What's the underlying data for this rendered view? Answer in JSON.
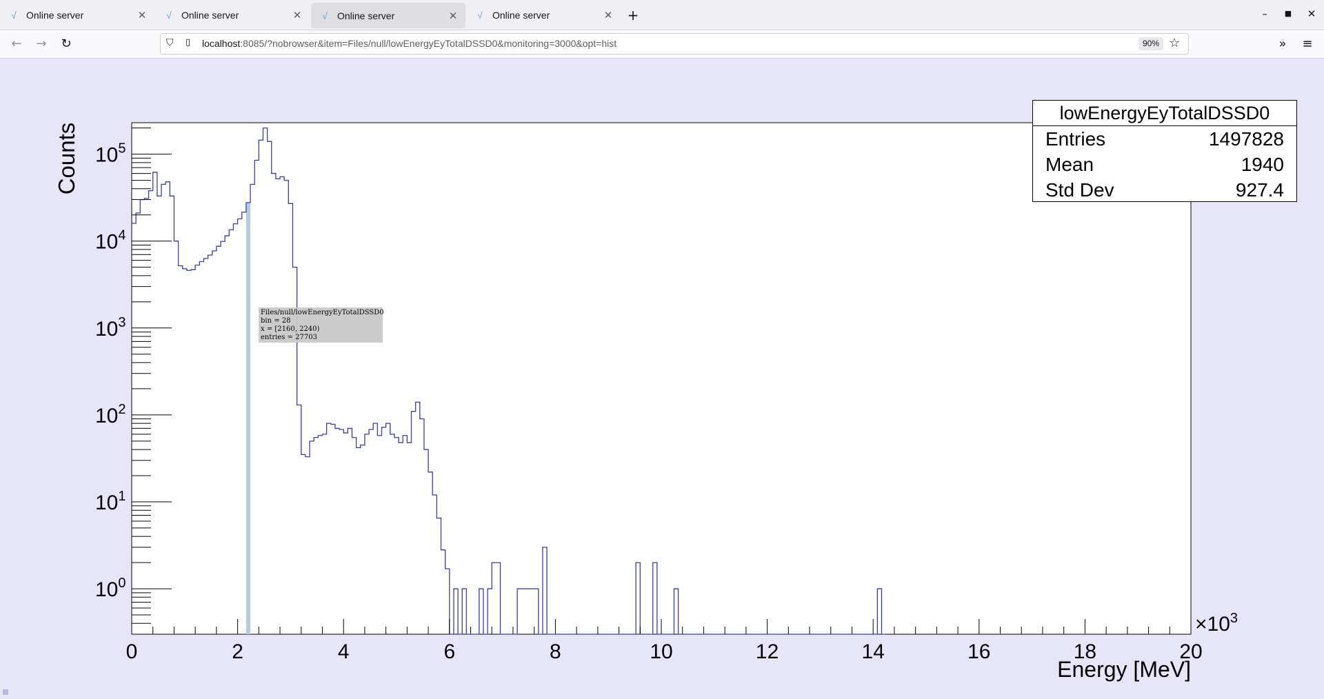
{
  "browser": {
    "tabs": [
      {
        "label": "Online server",
        "active": false
      },
      {
        "label": "Online server",
        "active": false
      },
      {
        "label": "Online server",
        "active": true
      },
      {
        "label": "Online server",
        "active": false
      }
    ],
    "url_host": "localhost",
    "url_rest": ":8085/?nobrowser&item=Files/null/lowEnergyEyTotalDSSD0&monitoring=3000&opt=hist",
    "zoom": "90%"
  },
  "tooltip": {
    "line1": "Files/null/lowEnergyEyTotalDSSD0",
    "line2": "bin = 28",
    "line3": "x = [2160, 2240)",
    "line4": "entries = 27703"
  },
  "stats": {
    "title": "lowEnergyEyTotalDSSD0",
    "rows": [
      {
        "label": "Entries",
        "value": "1497828"
      },
      {
        "label": "Mean",
        "value": "1940"
      },
      {
        "label": "Std Dev",
        "value": "927.4"
      }
    ]
  },
  "chart_data": {
    "type": "histogram",
    "xlabel": "Energy [MeV]",
    "ylabel": "Counts",
    "x_multiplier": "×10",
    "x_multiplier_exp": "3",
    "xlim": [
      0,
      20000
    ],
    "ylim": [
      0.3,
      230000
    ],
    "log_y": true,
    "x_ticks": [
      0,
      2,
      4,
      6,
      8,
      10,
      12,
      14,
      16,
      18,
      20
    ],
    "y_ticks": [
      {
        "base": "10",
        "exp": "0",
        "value": 1
      },
      {
        "base": "10",
        "exp": "1",
        "value": 10
      },
      {
        "base": "10",
        "exp": "2",
        "value": 100
      },
      {
        "base": "10",
        "exp": "3",
        "value": 1000
      },
      {
        "base": "10",
        "exp": "4",
        "value": 10000
      },
      {
        "base": "10",
        "exp": "5",
        "value": 100000
      }
    ],
    "bin_width": 80,
    "highlight_bin": {
      "x0": 2160,
      "x1": 2240
    },
    "line_color": "#3a3aa8",
    "highlight_color": "#b7c9e0",
    "bins": [
      [
        0,
        16000
      ],
      [
        80,
        21000
      ],
      [
        160,
        30000
      ],
      [
        240,
        31000
      ],
      [
        320,
        38000
      ],
      [
        400,
        62000
      ],
      [
        480,
        33000
      ],
      [
        560,
        45000
      ],
      [
        640,
        48000
      ],
      [
        720,
        33000
      ],
      [
        800,
        10000
      ],
      [
        880,
        5200
      ],
      [
        960,
        4800
      ],
      [
        1040,
        4600
      ],
      [
        1120,
        4700
      ],
      [
        1200,
        5300
      ],
      [
        1280,
        5800
      ],
      [
        1360,
        6300
      ],
      [
        1440,
        6900
      ],
      [
        1520,
        7700
      ],
      [
        1600,
        8700
      ],
      [
        1680,
        9900
      ],
      [
        1760,
        11500
      ],
      [
        1840,
        13500
      ],
      [
        1920,
        15800
      ],
      [
        2000,
        18000
      ],
      [
        2080,
        21500
      ],
      [
        2160,
        27703
      ],
      [
        2240,
        45000
      ],
      [
        2320,
        85000
      ],
      [
        2400,
        145000
      ],
      [
        2480,
        200000
      ],
      [
        2560,
        140000
      ],
      [
        2640,
        60000
      ],
      [
        2720,
        52000
      ],
      [
        2800,
        55000
      ],
      [
        2880,
        50000
      ],
      [
        2960,
        27000
      ],
      [
        3040,
        5000
      ],
      [
        3120,
        130
      ],
      [
        3200,
        35
      ],
      [
        3280,
        33
      ],
      [
        3360,
        50
      ],
      [
        3440,
        55
      ],
      [
        3520,
        58
      ],
      [
        3600,
        60
      ],
      [
        3680,
        80
      ],
      [
        3760,
        78
      ],
      [
        3840,
        70
      ],
      [
        3920,
        68
      ],
      [
        4000,
        62
      ],
      [
        4080,
        70
      ],
      [
        4160,
        55
      ],
      [
        4240,
        42
      ],
      [
        4320,
        45
      ],
      [
        4400,
        60
      ],
      [
        4480,
        68
      ],
      [
        4560,
        80
      ],
      [
        4640,
        58
      ],
      [
        4720,
        72
      ],
      [
        4800,
        80
      ],
      [
        4880,
        60
      ],
      [
        4960,
        55
      ],
      [
        5040,
        48
      ],
      [
        5120,
        58
      ],
      [
        5200,
        48
      ],
      [
        5280,
        110
      ],
      [
        5360,
        140
      ],
      [
        5440,
        90
      ],
      [
        5520,
        40
      ],
      [
        5600,
        22
      ],
      [
        5680,
        12
      ],
      [
        5760,
        6.5
      ],
      [
        5840,
        2.8
      ],
      [
        5920,
        1.7
      ],
      [
        6000,
        0.3
      ],
      [
        6080,
        1
      ],
      [
        6160,
        0.3
      ],
      [
        6240,
        1
      ],
      [
        6320,
        0.3
      ],
      [
        6400,
        0.3
      ],
      [
        6480,
        0.3
      ],
      [
        6560,
        1
      ],
      [
        6640,
        0.3
      ],
      [
        6720,
        1
      ],
      [
        6800,
        2
      ],
      [
        6880,
        2
      ],
      [
        6960,
        0.3
      ],
      [
        7040,
        0.3
      ],
      [
        7120,
        0.3
      ],
      [
        7200,
        0.3
      ],
      [
        7280,
        1
      ],
      [
        7360,
        1
      ],
      [
        7440,
        1
      ],
      [
        7520,
        1
      ],
      [
        7600,
        1
      ],
      [
        7680,
        0.3
      ],
      [
        7760,
        3
      ],
      [
        7840,
        0.3
      ],
      [
        8000,
        0.3
      ],
      [
        8480,
        0.3
      ],
      [
        8560,
        0.3
      ],
      [
        8640,
        0.3
      ],
      [
        8720,
        0.3
      ],
      [
        8800,
        0.3
      ],
      [
        8880,
        0.3
      ],
      [
        8960,
        0.3
      ],
      [
        9040,
        0.3
      ],
      [
        9120,
        0.3
      ],
      [
        9200,
        0.3
      ],
      [
        9280,
        0.3
      ],
      [
        9360,
        0.3
      ],
      [
        9440,
        0.3
      ],
      [
        9520,
        2
      ],
      [
        9600,
        0.3
      ],
      [
        9680,
        0.3
      ],
      [
        9760,
        0.3
      ],
      [
        9840,
        2
      ],
      [
        9920,
        0.3
      ],
      [
        10000,
        0.3
      ],
      [
        10080,
        0.3
      ],
      [
        10160,
        0.3
      ],
      [
        10240,
        1
      ],
      [
        10320,
        0.3
      ],
      [
        10400,
        0.3
      ],
      [
        14000,
        0.3
      ],
      [
        14080,
        1
      ],
      [
        14160,
        0.3
      ]
    ]
  }
}
